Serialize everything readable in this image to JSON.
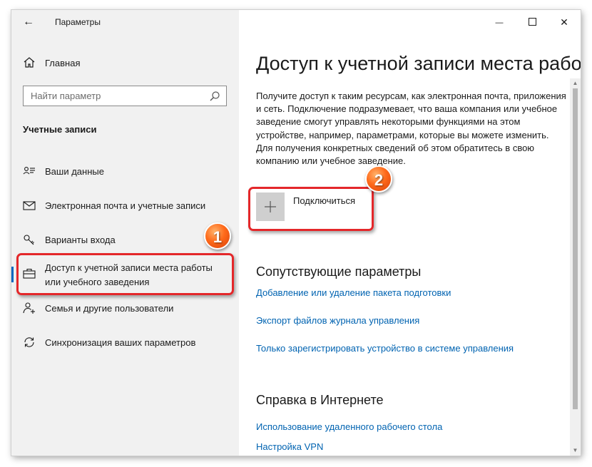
{
  "window": {
    "title": "Параметры",
    "back_glyph": "←",
    "minimize_glyph": "—",
    "close_glyph": "✕"
  },
  "sidebar": {
    "home_label": "Главная",
    "search_placeholder": "Найти параметр",
    "section_title": "Учетные записи",
    "items": [
      {
        "label": "Ваши данные",
        "icon": "user-list-icon"
      },
      {
        "label": "Электронная почта и учетные записи",
        "icon": "mail-icon"
      },
      {
        "label": "Варианты входа",
        "icon": "key-icon"
      },
      {
        "label": "Доступ к учетной записи места работы или учебного заведения",
        "icon": "briefcase-icon",
        "active": true
      },
      {
        "label": "Семья и другие пользователи",
        "icon": "add-person-icon"
      },
      {
        "label": "Синхронизация ваших параметров",
        "icon": "sync-icon"
      }
    ]
  },
  "main": {
    "title": "Доступ к учетной записи места рабо",
    "description": "Получите доступ к таким ресурсам, как электронная почта, приложения и сеть. Подключение подразумевает, что ваша компания или учебное заведение смогут управлять некоторыми функциями на этом устройстве, например, параметрами, которые вы можете изменить. Для получения конкретных сведений об этом обратитесь в свою компанию или учебное заведение.",
    "connect_label": "Подключиться",
    "related_title": "Сопутствующие параметры",
    "related_links": [
      "Добавление или удаление пакета подготовки",
      "Экспорт файлов журнала управления",
      "Только зарегистрировать устройство в системе управления"
    ],
    "help_title": "Справка в Интернете",
    "help_links": [
      "Использование удаленного рабочего стола",
      "Настройка VPN"
    ]
  },
  "annotations": [
    {
      "number": "1"
    },
    {
      "number": "2"
    }
  ],
  "colors": {
    "accent": "#0067c0",
    "link": "#0063b1",
    "annotation_red": "#e4272a",
    "annotation_orange": "#ff6a1a",
    "sidebar_bg": "#f1f1f1"
  }
}
